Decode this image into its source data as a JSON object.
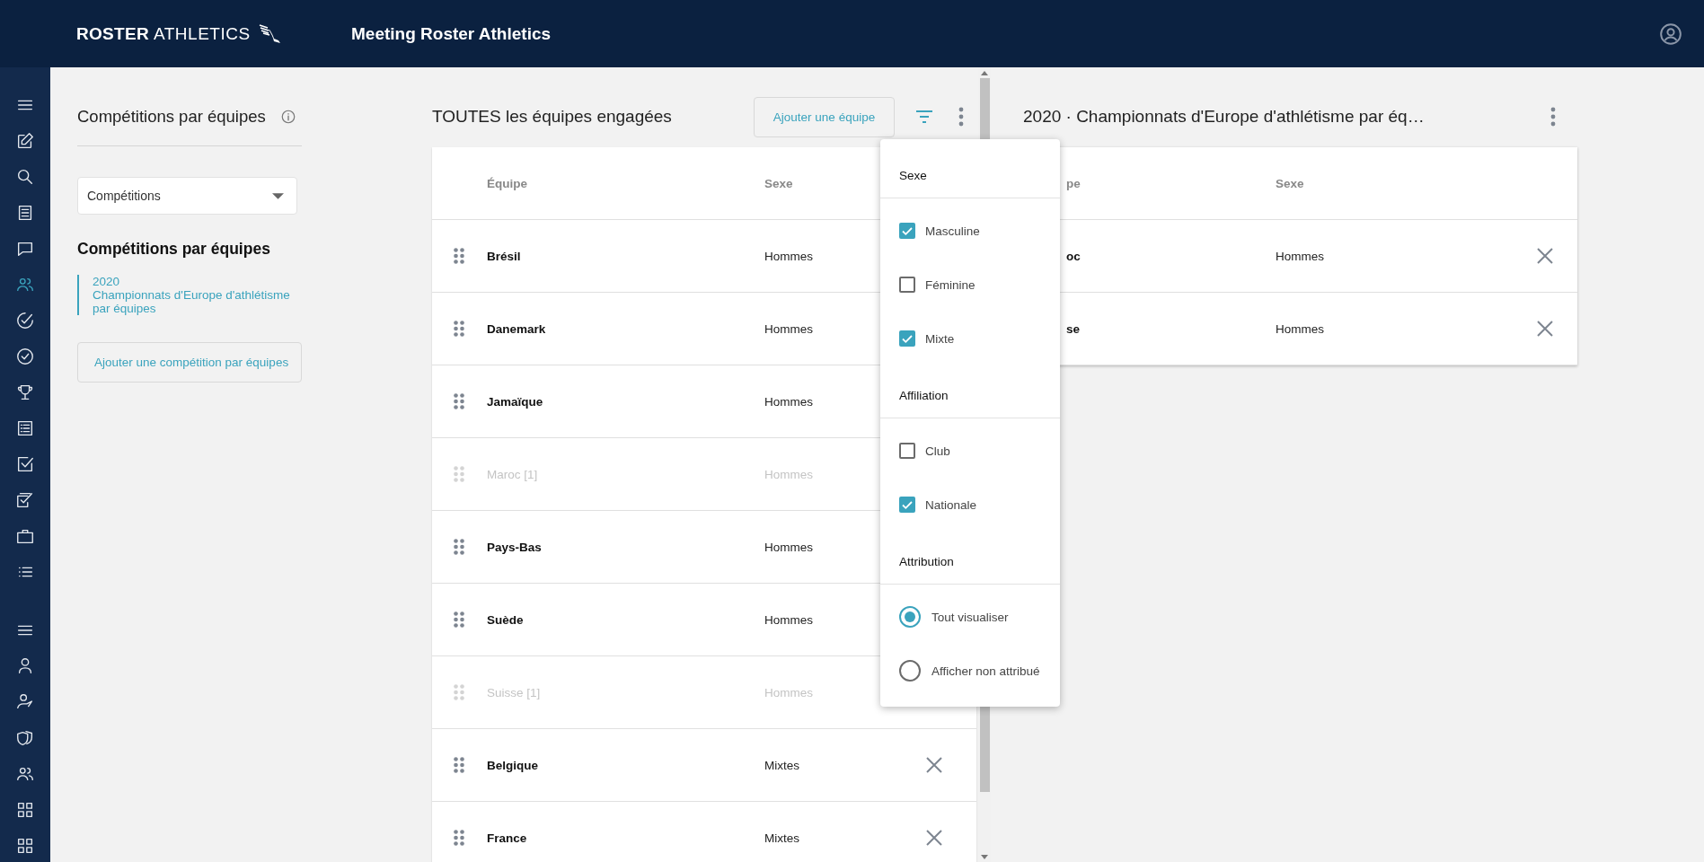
{
  "header": {
    "logo_bold": "ROSTER",
    "logo_light": "ATHLETICS",
    "title": "Meeting Roster Athletics"
  },
  "sidebar": {
    "groups": [
      [
        {
          "selected": false
        },
        {
          "selected": false
        },
        {
          "selected": false
        },
        {
          "selected": false
        },
        {
          "selected": false
        },
        {
          "selected": true
        },
        {
          "selected": false
        },
        {
          "selected": false
        },
        {
          "selected": false
        },
        {
          "selected": false
        },
        {
          "selected": false
        },
        {
          "selected": false
        },
        {
          "selected": false
        },
        {
          "selected": false
        }
      ],
      [
        {
          "selected": false
        },
        {
          "selected": false
        },
        {
          "selected": false
        },
        {
          "selected": false
        },
        {
          "selected": false
        },
        {
          "selected": false
        },
        {
          "selected": false
        }
      ]
    ]
  },
  "competitions_panel": {
    "title": "Compétitions par équipes",
    "select": {
      "value": "Compétitions"
    },
    "subtitle": "Compétitions par équipes",
    "items": [
      {
        "year": "2020",
        "name": "Championnats d'Europe d'athlétisme par équipes",
        "selected": true
      }
    ],
    "add_button": "Ajouter une compétition par équipes"
  },
  "teams_panel": {
    "title": "TOUTES les équipes engagées",
    "add_button": "Ajouter une équipe",
    "columns": [
      "Équipe",
      "Sexe"
    ],
    "rows": [
      {
        "team": "Brésil",
        "sex": "Hommes",
        "disabled": false,
        "removable": false
      },
      {
        "team": "Danemark",
        "sex": "Hommes",
        "disabled": false,
        "removable": false
      },
      {
        "team": "Jamaïque",
        "sex": "Hommes",
        "disabled": false,
        "removable": false
      },
      {
        "team": "Maroc [1]",
        "sex": "Hommes",
        "disabled": true,
        "removable": false
      },
      {
        "team": "Pays-Bas",
        "sex": "Hommes",
        "disabled": false,
        "removable": false
      },
      {
        "team": "Suède",
        "sex": "Hommes",
        "disabled": false,
        "removable": false
      },
      {
        "team": "Suisse [1]",
        "sex": "Hommes",
        "disabled": true,
        "removable": false
      },
      {
        "team": "Belgique",
        "sex": "Mixtes",
        "disabled": false,
        "removable": true
      },
      {
        "team": "France",
        "sex": "Mixtes",
        "disabled": false,
        "removable": true
      }
    ]
  },
  "filter_menu": {
    "sections": [
      {
        "title": "Sexe",
        "options": [
          {
            "kind": "checkbox",
            "label": "Masculine",
            "checked": true
          },
          {
            "kind": "checkbox",
            "label": "Féminine",
            "checked": false
          },
          {
            "kind": "checkbox",
            "label": "Mixte",
            "checked": true
          }
        ]
      },
      {
        "title": "Affiliation",
        "options": [
          {
            "kind": "checkbox",
            "label": "Club",
            "checked": false
          },
          {
            "kind": "checkbox",
            "label": "Nationale",
            "checked": true
          }
        ]
      },
      {
        "title": "Attribution",
        "options": [
          {
            "kind": "radio",
            "label": "Tout visualiser",
            "selected": true
          },
          {
            "kind": "radio",
            "label": "Afficher non attribué",
            "selected": false
          }
        ]
      }
    ]
  },
  "competition_panel": {
    "title": "2020 · Championnats d'Europe d'athlétisme par éq…",
    "columns": [
      "pe",
      "Sexe"
    ],
    "rows": [
      {
        "team": "oc",
        "sex": "Hommes"
      },
      {
        "team": "se",
        "sex": "Hommes"
      }
    ]
  }
}
